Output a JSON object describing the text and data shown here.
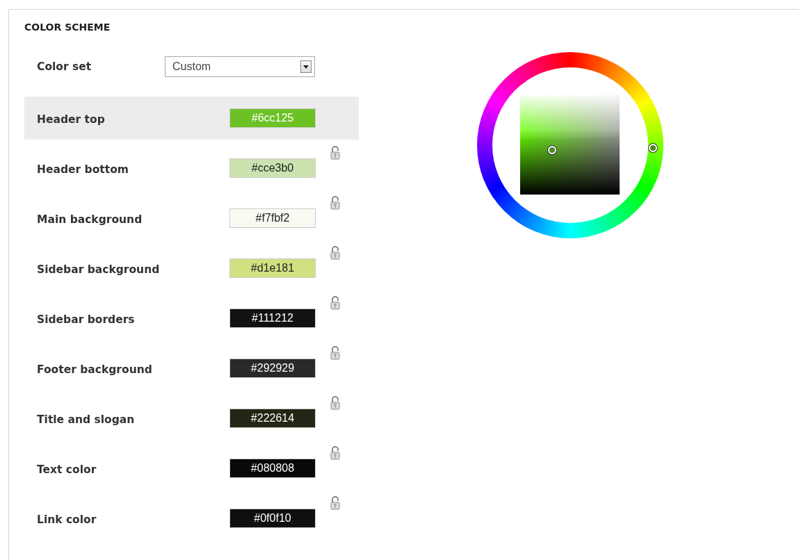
{
  "section": {
    "title": "COLOR SCHEME"
  },
  "color_set": {
    "label": "Color set",
    "value": "Custom"
  },
  "fields": [
    {
      "label": "Header top",
      "value": "#6cc125",
      "color": "#6cc125",
      "selected": true
    },
    {
      "label": "Header bottom",
      "value": "#cce3b0",
      "color": "#cce3b0",
      "selected": false
    },
    {
      "label": "Main background",
      "value": "#f7fbf2",
      "color": "#f7fbf2",
      "selected": false
    },
    {
      "label": "Sidebar background",
      "value": "#d1e181",
      "color": "#d1e181",
      "selected": false
    },
    {
      "label": "Sidebar borders",
      "value": "#111212",
      "color": "#111212",
      "selected": false
    },
    {
      "label": "Footer background",
      "value": "#292929",
      "color": "#292929",
      "selected": false
    },
    {
      "label": "Title and slogan",
      "value": "#222614",
      "color": "#222614",
      "selected": false
    },
    {
      "label": "Text color",
      "value": "#080808",
      "color": "#080808",
      "selected": false
    },
    {
      "label": "Link color",
      "value": "#0f0f10",
      "color": "#0f0f10",
      "selected": false
    }
  ]
}
